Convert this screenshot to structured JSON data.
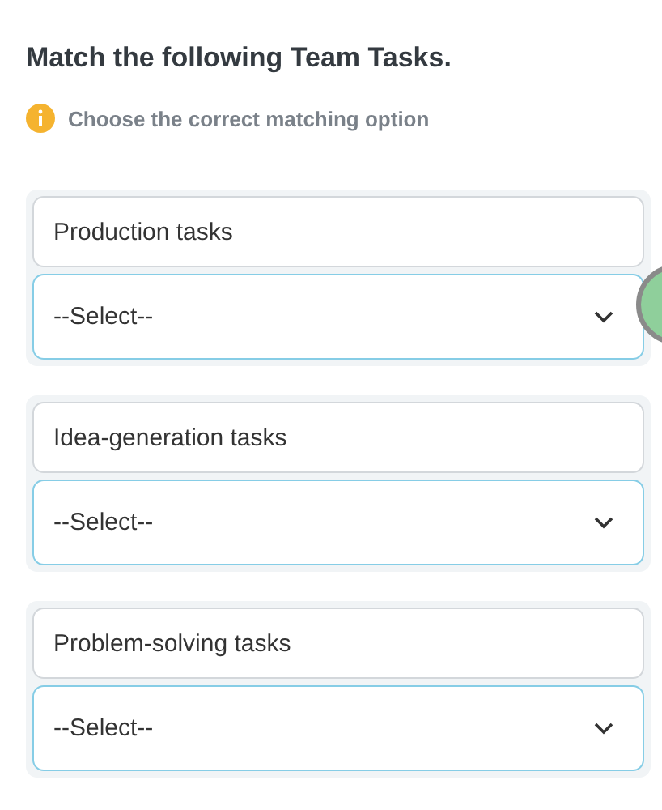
{
  "title": "Match the following Team Tasks.",
  "hint": "Choose the correct matching option",
  "items": [
    {
      "prompt": "Production tasks",
      "value": "--Select--"
    },
    {
      "prompt": "Idea-generation tasks",
      "value": "--Select--"
    },
    {
      "prompt": "Problem-solving tasks",
      "value": "--Select--"
    }
  ]
}
